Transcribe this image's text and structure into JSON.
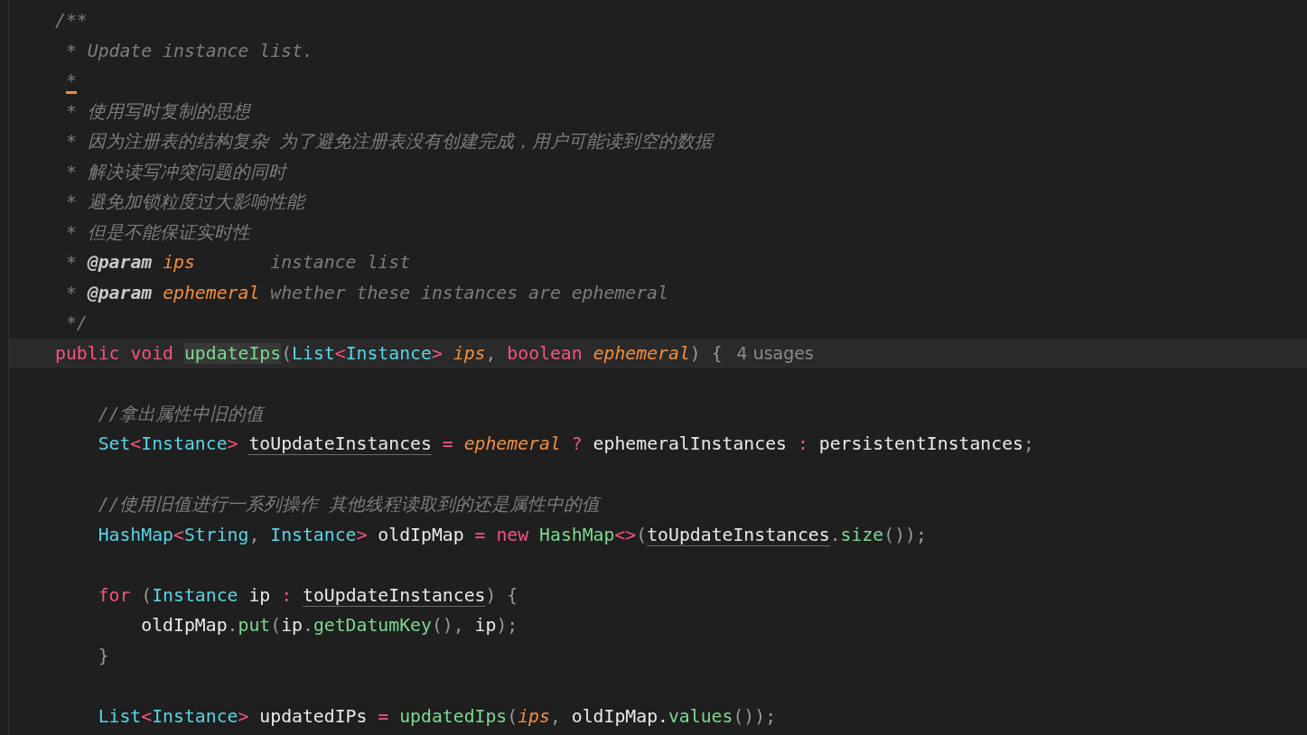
{
  "editor": {
    "lines": [
      {
        "kind": "code",
        "words": [
          [
            {
              "kind": "comment",
              "text": "/**"
            }
          ]
        ]
      },
      {
        "kind": "doc",
        "words": [
          [
            {
              "kind": "comment",
              "text": "* Update instance list."
            }
          ]
        ]
      },
      {
        "kind": "doc",
        "words": [
          [
            {
              "kind": "marked",
              "text": "*"
            }
          ]
        ]
      },
      {
        "kind": "doc",
        "words": [
          [
            {
              "kind": "comment",
              "text": "* 使用写时复制的思想"
            }
          ]
        ]
      },
      {
        "kind": "doc",
        "words": [
          [
            {
              "kind": "comment",
              "text": "* 因为注册表的结构复杂 为了避免注册表没有创建完成，用户可能读到空的数据"
            }
          ]
        ]
      },
      {
        "kind": "doc",
        "words": [
          [
            {
              "kind": "comment",
              "text": "* 解决读写冲突问题的同时"
            }
          ]
        ]
      },
      {
        "kind": "doc",
        "words": [
          [
            {
              "kind": "comment",
              "text": "* 避免加锁粒度过大影响性能"
            }
          ]
        ]
      },
      {
        "kind": "doc",
        "words": [
          [
            {
              "kind": "comment",
              "text": "* 但是不能保证实时性"
            }
          ]
        ]
      },
      {
        "kind": "doc",
        "words": [
          [
            {
              "kind": "comment",
              "text": "*"
            }
          ],
          [
            {
              "kind": "doctag",
              "text": "@param"
            }
          ],
          [
            {
              "kind": "docparam",
              "text": "ips"
            }
          ],
          [
            {
              "kind": "comment",
              "text": "instance list"
            }
          ]
        ]
      },
      {
        "kind": "doc",
        "words": [
          [
            {
              "kind": "comment",
              "text": "*"
            }
          ],
          [
            {
              "kind": "doctag",
              "text": "@param"
            }
          ],
          [
            {
              "kind": "docparam",
              "text": "ephemeral"
            }
          ],
          [
            {
              "kind": "comment",
              "text": "whether these instances are ephemeral"
            }
          ]
        ]
      },
      {
        "kind": "doc",
        "words": [
          [
            {
              "kind": "comment",
              "text": "*/"
            }
          ]
        ]
      },
      {
        "kind": "current",
        "words": [
          [
            {
              "kind": "keyword",
              "text": "public"
            }
          ],
          [
            {
              "kind": "keyword",
              "text": "void"
            }
          ],
          [
            {
              "kind": "decl",
              "text": "updateIps"
            },
            {
              "kind": "punct",
              "text": "("
            },
            {
              "kind": "type",
              "text": "List"
            },
            {
              "kind": "operator",
              "text": "<"
            },
            {
              "kind": "type",
              "text": "Instance"
            },
            {
              "kind": "operator",
              "text": ">"
            }
          ],
          [
            {
              "kind": "param",
              "text": "ips"
            },
            {
              "kind": "punct",
              "text": ","
            }
          ],
          [
            {
              "kind": "keyword",
              "text": "boolean"
            }
          ],
          [
            {
              "kind": "param",
              "text": "ephemeral"
            },
            {
              "kind": "punct",
              "text": ")"
            }
          ],
          [
            {
              "kind": "punct",
              "text": "{"
            }
          ],
          [
            {
              "kind": "hint",
              "text": "4 usages"
            }
          ]
        ]
      },
      {
        "kind": "blank"
      },
      {
        "kind": "body",
        "words": [
          [
            {
              "kind": "comment",
              "text": "//拿出属性中旧的值"
            }
          ]
        ]
      },
      {
        "kind": "body",
        "words": [
          [
            {
              "kind": "type",
              "text": "Set"
            },
            {
              "kind": "operator",
              "text": "<"
            },
            {
              "kind": "type",
              "text": "Instance"
            },
            {
              "kind": "operator",
              "text": ">"
            }
          ],
          [
            {
              "kind": "underlined",
              "text": "toUpdateInstances"
            }
          ],
          [
            {
              "kind": "operator",
              "text": "="
            }
          ],
          [
            {
              "kind": "param",
              "text": "ephemeral"
            }
          ],
          [
            {
              "kind": "operator",
              "text": "?"
            }
          ],
          [
            {
              "kind": "plain",
              "text": "ephemeralInstances"
            }
          ],
          [
            {
              "kind": "operator",
              "text": ":"
            }
          ],
          [
            {
              "kind": "plain",
              "text": "persistentInstances"
            },
            {
              "kind": "punct",
              "text": ";"
            }
          ]
        ]
      },
      {
        "kind": "blank"
      },
      {
        "kind": "body",
        "words": [
          [
            {
              "kind": "comment",
              "text": "//使用旧值进行一系列操作 其他线程读取到的还是属性中的值"
            }
          ]
        ]
      },
      {
        "kind": "body",
        "words": [
          [
            {
              "kind": "type",
              "text": "HashMap"
            },
            {
              "kind": "operator",
              "text": "<"
            },
            {
              "kind": "type",
              "text": "String"
            },
            {
              "kind": "punct",
              "text": ","
            }
          ],
          [
            {
              "kind": "type",
              "text": "Instance"
            },
            {
              "kind": "operator",
              "text": ">"
            }
          ],
          [
            {
              "kind": "plain",
              "text": "oldIpMap"
            }
          ],
          [
            {
              "kind": "operator",
              "text": "="
            }
          ],
          [
            {
              "kind": "keyword",
              "text": "new"
            }
          ],
          [
            {
              "kind": "call",
              "text": "HashMap"
            },
            {
              "kind": "operator",
              "text": "<>"
            },
            {
              "kind": "punct",
              "text": "("
            },
            {
              "kind": "underlined",
              "text": "toUpdateInstances"
            },
            {
              "kind": "punct",
              "text": "."
            },
            {
              "kind": "call",
              "text": "size"
            },
            {
              "kind": "punct",
              "text": "());"
            }
          ]
        ]
      },
      {
        "kind": "blank"
      },
      {
        "kind": "body",
        "words": [
          [
            {
              "kind": "keyword",
              "text": "for"
            }
          ],
          [
            {
              "kind": "punct",
              "text": "("
            },
            {
              "kind": "type",
              "text": "Instance"
            }
          ],
          [
            {
              "kind": "plain",
              "text": "ip"
            }
          ],
          [
            {
              "kind": "operator",
              "text": ":"
            }
          ],
          [
            {
              "kind": "underlined",
              "text": "toUpdateInstances"
            },
            {
              "kind": "punct",
              "text": ")"
            }
          ],
          [
            {
              "kind": "punct",
              "text": "{"
            }
          ]
        ]
      },
      {
        "kind": "nested",
        "words": [
          [
            {
              "kind": "plain",
              "text": "oldIpMap"
            },
            {
              "kind": "punct",
              "text": "."
            },
            {
              "kind": "call",
              "text": "put"
            },
            {
              "kind": "punct",
              "text": "("
            },
            {
              "kind": "plain",
              "text": "ip"
            },
            {
              "kind": "punct",
              "text": "."
            },
            {
              "kind": "call",
              "text": "getDatumKey"
            },
            {
              "kind": "punct",
              "text": "(),"
            }
          ],
          [
            {
              "kind": "plain",
              "text": "ip"
            },
            {
              "kind": "punct",
              "text": ");"
            }
          ]
        ]
      },
      {
        "kind": "body",
        "words": [
          [
            {
              "kind": "punct",
              "text": "}"
            }
          ]
        ]
      },
      {
        "kind": "blank"
      },
      {
        "kind": "body",
        "words": [
          [
            {
              "kind": "type",
              "text": "List"
            },
            {
              "kind": "operator",
              "text": "<"
            },
            {
              "kind": "type",
              "text": "Instance"
            },
            {
              "kind": "operator",
              "text": ">"
            }
          ],
          [
            {
              "kind": "plain",
              "text": "updatedIPs"
            }
          ],
          [
            {
              "kind": "operator",
              "text": "="
            }
          ],
          [
            {
              "kind": "call",
              "text": "updatedIps"
            },
            {
              "kind": "punct",
              "text": "("
            },
            {
              "kind": "param",
              "text": "ips"
            },
            {
              "kind": "punct",
              "text": ","
            }
          ],
          [
            {
              "kind": "plain",
              "text": "oldIpMap."
            },
            {
              "kind": "call",
              "text": "values"
            },
            {
              "kind": "punct",
              "text": "());"
            }
          ]
        ]
      }
    ]
  }
}
